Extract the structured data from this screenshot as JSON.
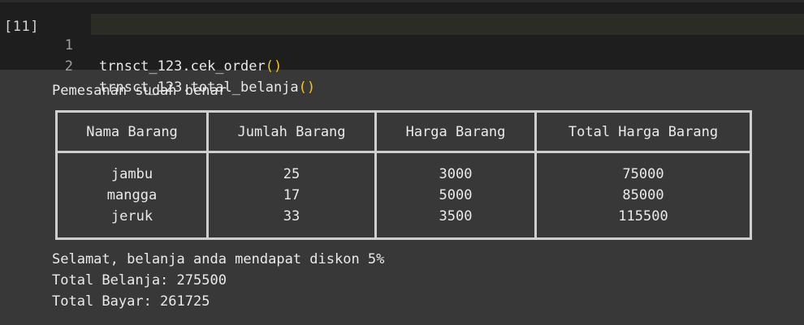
{
  "cell": {
    "execution_count": "[11]",
    "lines": [
      {
        "number": "1",
        "object": "trnsct_123",
        "method": ".cek_order",
        "parens": "()"
      },
      {
        "number": "2",
        "object": "trnsct_123",
        "method": ".total_belanja",
        "parens": "()"
      }
    ]
  },
  "output": {
    "status_message": "Pemesanan sudah benar",
    "table": {
      "headers": [
        "Nama Barang",
        "Jumlah Barang",
        "Harga Barang",
        "Total Harga Barang"
      ],
      "rows": [
        [
          "jambu",
          "25",
          "3000",
          "75000"
        ],
        [
          "mangga",
          "17",
          "5000",
          "85000"
        ],
        [
          "jeruk",
          "33",
          "3500",
          "115500"
        ]
      ]
    },
    "discount_message": "Selamat, belanja anda mendapat diskon 5%",
    "total_belanja": "Total Belanja: 275500",
    "total_bayar": "Total Bayar: 261725"
  }
}
